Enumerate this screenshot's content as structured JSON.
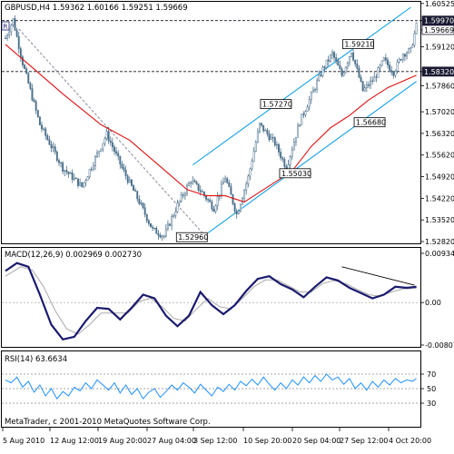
{
  "chart_data": [
    {
      "type": "candlestick",
      "panel": "price",
      "title": "GBPUSD,H4  1.59362 1.60166 1.59251 1.59669",
      "yticks": [
        "1.60525",
        "1.59970",
        "1.59669",
        "1.59120",
        "1.58320",
        "1.57860",
        "1.57020",
        "1.56320",
        "1.55620",
        "1.54920",
        "1.54220",
        "1.53520",
        "1.52820"
      ],
      "ylim": [
        1.5282,
        1.6052
      ],
      "price_labels": [
        {
          "text": "1.59210",
          "value": 1.5921
        },
        {
          "text": "1.57270",
          "value": 1.5727
        },
        {
          "text": "1.56680",
          "value": 1.5668
        },
        {
          "text": "1.55030",
          "value": 1.5503
        },
        {
          "text": "1.52960",
          "value": 1.5296
        }
      ],
      "horizontal_levels": [
        1.5997,
        1.5832
      ],
      "highlighted_levels": [
        {
          "text": "1.59970",
          "value": 1.5997,
          "style": "dark"
        },
        {
          "text": "1.59669",
          "value": 1.59669,
          "style": "light"
        },
        {
          "text": "1.58320",
          "value": 1.5832,
          "style": "dark"
        }
      ],
      "close_anchors": [
        [
          0,
          1.594
        ],
        [
          4,
          1.6
        ],
        [
          9,
          1.586
        ],
        [
          18,
          1.566
        ],
        [
          30,
          1.552
        ],
        [
          40,
          1.546
        ],
        [
          53,
          1.563
        ],
        [
          61,
          1.552
        ],
        [
          70,
          1.541
        ],
        [
          77,
          1.532
        ],
        [
          83,
          1.53
        ],
        [
          90,
          1.54
        ],
        [
          97,
          1.548
        ],
        [
          103,
          1.544
        ],
        [
          109,
          1.539
        ],
        [
          115,
          1.549
        ],
        [
          121,
          1.537
        ],
        [
          127,
          1.549
        ],
        [
          133,
          1.566
        ],
        [
          141,
          1.56
        ],
        [
          147,
          1.552
        ],
        [
          154,
          1.567
        ],
        [
          159,
          1.574
        ],
        [
          166,
          1.584
        ],
        [
          171,
          1.589
        ],
        [
          176,
          1.582
        ],
        [
          181,
          1.59
        ],
        [
          187,
          1.577
        ],
        [
          193,
          1.581
        ],
        [
          198,
          1.587
        ],
        [
          203,
          1.583
        ],
        [
          208,
          1.589
        ],
        [
          212,
          1.59
        ],
        [
          215,
          1.598
        ]
      ],
      "ma_line": [
        [
          0,
          1.592
        ],
        [
          15,
          1.584
        ],
        [
          30,
          1.576
        ],
        [
          50,
          1.566
        ],
        [
          65,
          1.561
        ],
        [
          80,
          1.553
        ],
        [
          95,
          1.545
        ],
        [
          105,
          1.543
        ],
        [
          115,
          1.543
        ],
        [
          125,
          1.541
        ],
        [
          135,
          1.545
        ],
        [
          150,
          1.551
        ],
        [
          160,
          1.559
        ],
        [
          170,
          1.565
        ],
        [
          180,
          1.569
        ],
        [
          190,
          1.574
        ],
        [
          200,
          1.578
        ],
        [
          215,
          1.582
        ]
      ],
      "channel_upper": [
        [
          98,
          1.553
        ],
        [
          212,
          1.604
        ]
      ],
      "channel_lower": [
        [
          106,
          1.531
        ],
        [
          215,
          1.58
        ]
      ],
      "trend_line": [
        [
          7,
          1.597
        ],
        [
          106,
          1.529
        ]
      ],
      "colors": {
        "candle": "#4a6f8a",
        "ma": "#e01010",
        "channel": "#0099e6",
        "trend": "#8a8aa0",
        "level": "#111122"
      }
    },
    {
      "type": "line",
      "panel": "macd",
      "title": "MACD(12,26,9) 0.002969 0.002730",
      "yticks": [
        "0.009348",
        "0.00",
        "-0.00807"
      ],
      "ylim": [
        -0.00807,
        0.009348
      ],
      "series": [
        {
          "values": [
            [
              0,
              0.006
            ],
            [
              6,
              0.0075
            ],
            [
              12,
              0.0068
            ],
            [
              18,
              0.0015
            ],
            [
              24,
              -0.0042
            ],
            [
              30,
              -0.007
            ],
            [
              36,
              -0.0065
            ],
            [
              42,
              -0.0035
            ],
            [
              48,
              -0.001
            ],
            [
              54,
              -0.0012
            ],
            [
              60,
              -0.0032
            ],
            [
              66,
              -0.001
            ],
            [
              72,
              0.0015
            ],
            [
              78,
              0.0008
            ],
            [
              84,
              -0.0025
            ],
            [
              90,
              -0.0045
            ],
            [
              96,
              -0.0025
            ],
            [
              102,
              0.002
            ],
            [
              108,
              -0.0005
            ],
            [
              114,
              -0.0022
            ],
            [
              120,
              -0.0005
            ],
            [
              126,
              0.0022
            ],
            [
              132,
              0.0045
            ],
            [
              138,
              0.005
            ],
            [
              144,
              0.0035
            ],
            [
              150,
              0.0025
            ],
            [
              156,
              0.001
            ],
            [
              162,
              0.003
            ],
            [
              168,
              0.0048
            ],
            [
              174,
              0.0042
            ],
            [
              180,
              0.0028
            ],
            [
              186,
              0.0018
            ],
            [
              192,
              0.0008
            ],
            [
              198,
              0.0015
            ],
            [
              204,
              0.003
            ],
            [
              210,
              0.0028
            ],
            [
              215,
              0.003
            ]
          ]
        },
        {
          "values": [
            [
              0,
              0.005
            ],
            [
              8,
              0.0068
            ],
            [
              14,
              0.0062
            ],
            [
              20,
              0.003
            ],
            [
              26,
              -0.0015
            ],
            [
              32,
              -0.005
            ],
            [
              38,
              -0.006
            ],
            [
              44,
              -0.0042
            ],
            [
              50,
              -0.002
            ],
            [
              58,
              -0.002
            ],
            [
              64,
              -0.002
            ],
            [
              70,
              0.0002
            ],
            [
              76,
              0.0008
            ],
            [
              82,
              -0.0008
            ],
            [
              88,
              -0.003
            ],
            [
              94,
              -0.0035
            ],
            [
              100,
              -0.0012
            ],
            [
              106,
              0.0008
            ],
            [
              112,
              -0.0008
            ],
            [
              118,
              -0.0012
            ],
            [
              124,
              0.0008
            ],
            [
              130,
              0.003
            ],
            [
              136,
              0.0043
            ],
            [
              142,
              0.0043
            ],
            [
              148,
              0.0032
            ],
            [
              154,
              0.002
            ],
            [
              160,
              0.002
            ],
            [
              166,
              0.0036
            ],
            [
              172,
              0.0042
            ],
            [
              178,
              0.0036
            ],
            [
              184,
              0.0025
            ],
            [
              190,
              0.0015
            ],
            [
              196,
              0.0012
            ],
            [
              202,
              0.002
            ],
            [
              208,
              0.0026
            ],
            [
              215,
              0.0027
            ]
          ]
        }
      ],
      "divergence_line": [
        [
          176,
          0.0068
        ],
        [
          214,
          0.0033
        ]
      ],
      "colors": {
        "macd": "#1a1a6e",
        "signal": "#aaaaaa",
        "divergence": "#000000"
      }
    },
    {
      "type": "line",
      "panel": "rsi",
      "title": "RSI(14) 63.6634",
      "yticks": [
        "70",
        "50",
        "30"
      ],
      "ylim": [
        0,
        100
      ],
      "levels": [
        70,
        50,
        30
      ],
      "values": [
        [
          0,
          62
        ],
        [
          3,
          58
        ],
        [
          6,
          66
        ],
        [
          9,
          52
        ],
        [
          12,
          60
        ],
        [
          15,
          45
        ],
        [
          18,
          55
        ],
        [
          21,
          40
        ],
        [
          24,
          50
        ],
        [
          27,
          36
        ],
        [
          30,
          46
        ],
        [
          33,
          40
        ],
        [
          36,
          52
        ],
        [
          39,
          47
        ],
        [
          42,
          58
        ],
        [
          45,
          50
        ],
        [
          48,
          62
        ],
        [
          51,
          55
        ],
        [
          54,
          48
        ],
        [
          57,
          58
        ],
        [
          60,
          44
        ],
        [
          63,
          55
        ],
        [
          66,
          42
        ],
        [
          69,
          50
        ],
        [
          72,
          36
        ],
        [
          75,
          45
        ],
        [
          78,
          50
        ],
        [
          81,
          38
        ],
        [
          84,
          46
        ],
        [
          87,
          55
        ],
        [
          90,
          48
        ],
        [
          93,
          58
        ],
        [
          96,
          52
        ],
        [
          99,
          44
        ],
        [
          102,
          56
        ],
        [
          105,
          48
        ],
        [
          108,
          40
        ],
        [
          111,
          52
        ],
        [
          114,
          46
        ],
        [
          117,
          56
        ],
        [
          120,
          48
        ],
        [
          123,
          60
        ],
        [
          126,
          54
        ],
        [
          129,
          63
        ],
        [
          132,
          55
        ],
        [
          135,
          66
        ],
        [
          138,
          56
        ],
        [
          141,
          48
        ],
        [
          144,
          58
        ],
        [
          147,
          50
        ],
        [
          150,
          62
        ],
        [
          153,
          55
        ],
        [
          156,
          66
        ],
        [
          159,
          58
        ],
        [
          162,
          68
        ],
        [
          165,
          60
        ],
        [
          168,
          70
        ],
        [
          171,
          62
        ],
        [
          174,
          66
        ],
        [
          177,
          56
        ],
        [
          180,
          64
        ],
        [
          183,
          50
        ],
        [
          186,
          58
        ],
        [
          189,
          48
        ],
        [
          192,
          60
        ],
        [
          195,
          52
        ],
        [
          198,
          62
        ],
        [
          201,
          55
        ],
        [
          204,
          64
        ],
        [
          207,
          58
        ],
        [
          210,
          62
        ],
        [
          213,
          60
        ],
        [
          215,
          64
        ]
      ],
      "colors": {
        "rsi": "#1e90ff",
        "level": "#888888"
      }
    }
  ],
  "xticks": [
    "5 Aug 2010",
    "12 Aug 12:00",
    "19 Aug 20:00",
    "27 Aug 04:00",
    "3 Sep 12:00",
    "10 Sep 20:00",
    "20 Sep 04:00",
    "27 Sep 12:00",
    "4 Oct 20:00"
  ],
  "corner_label": "R",
  "footer": "MetaTrader, c 2001-2010 MetaQuotes Software Corp."
}
